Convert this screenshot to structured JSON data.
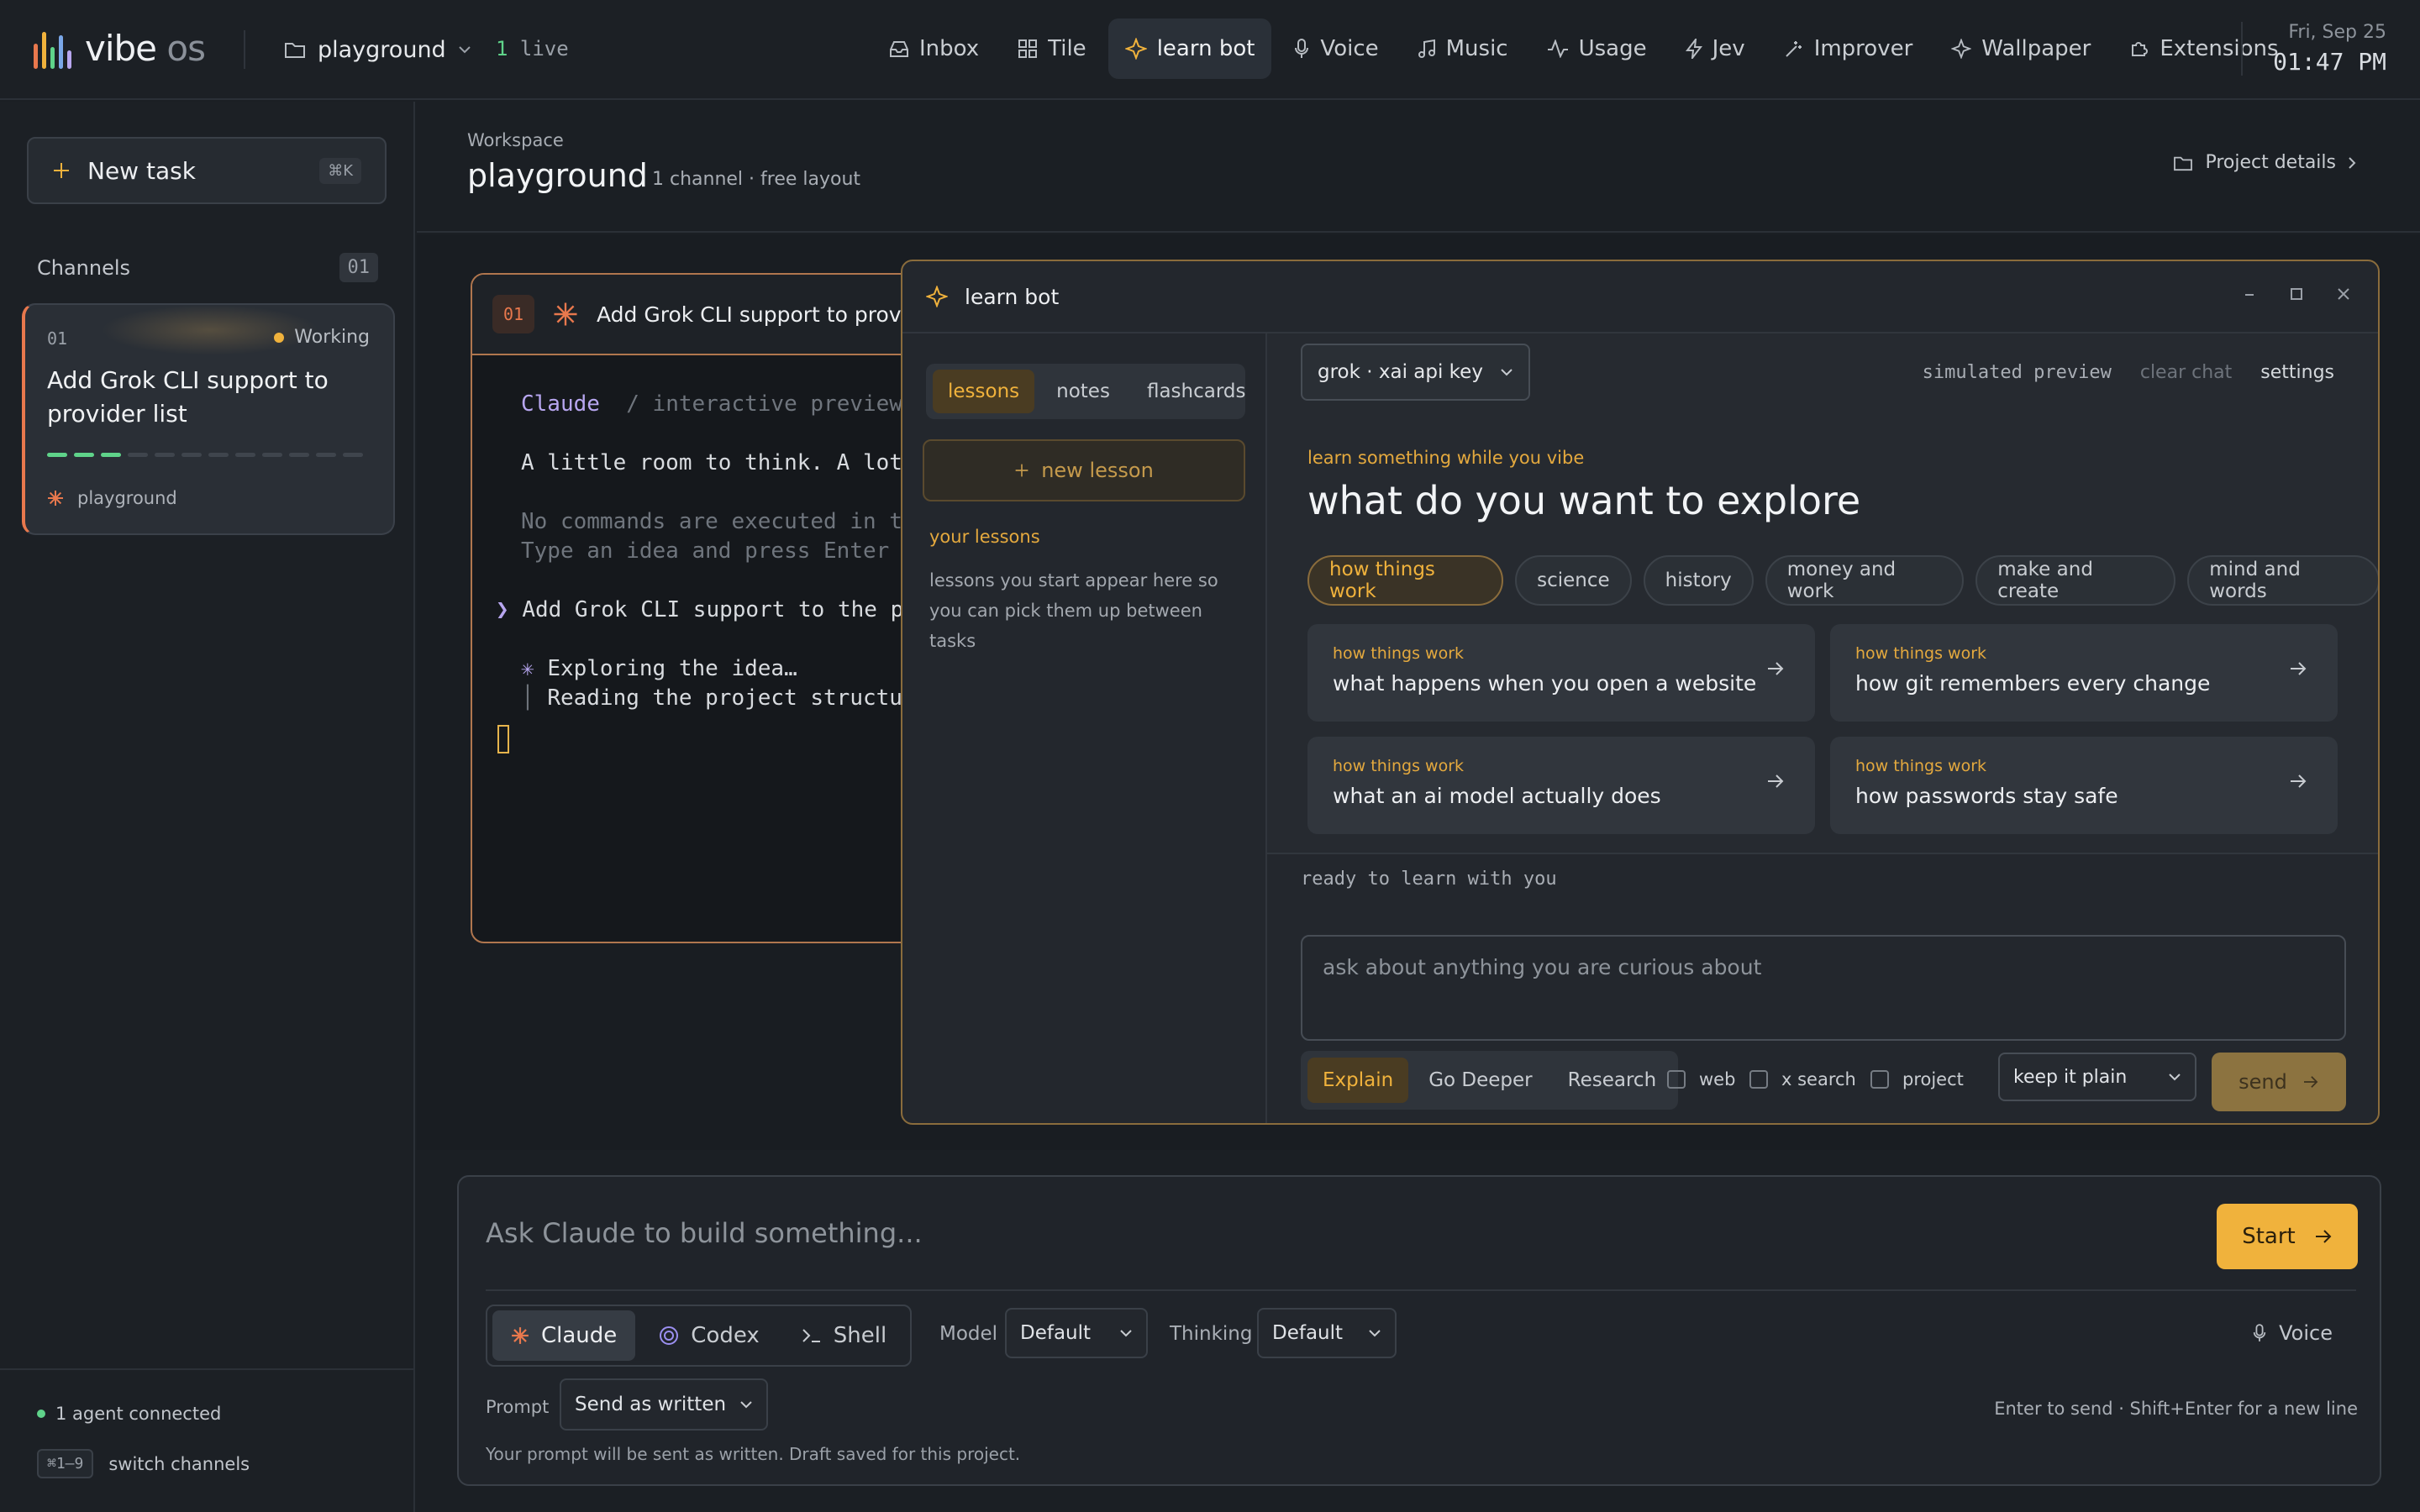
{
  "brand": {
    "name": "vibe",
    "suffix": "os",
    "bar_colors": [
      "#e8784d",
      "#f0b23c",
      "#5fd38a",
      "#7aa7e8",
      "#b7a6ef"
    ]
  },
  "header": {
    "project": "playground",
    "live_count": "1",
    "live_label": "live",
    "nav": [
      {
        "label": "Inbox",
        "icon": "inbox-icon"
      },
      {
        "label": "Tile",
        "icon": "grid-icon"
      },
      {
        "label": "learn bot",
        "icon": "sparkle-icon",
        "active": true
      },
      {
        "label": "Voice",
        "icon": "mic-icon"
      },
      {
        "label": "Music",
        "icon": "music-icon"
      },
      {
        "label": "Usage",
        "icon": "activity-icon"
      },
      {
        "label": "Jev",
        "icon": "bolt-icon"
      },
      {
        "label": "Improver",
        "icon": "wand-icon"
      },
      {
        "label": "Wallpaper",
        "icon": "sparkle-icon"
      },
      {
        "label": "Extensions",
        "icon": "puzzle-icon"
      }
    ],
    "date": "Fri, Sep 25",
    "time": "01:47 PM"
  },
  "sidebar": {
    "new_task": "New task",
    "new_task_shortcut": "⌘K",
    "channels_label": "Channels",
    "channels_count": "01",
    "channel": {
      "num": "01",
      "status": "Working",
      "title": "Add Grok CLI support to provider list",
      "project": "playground",
      "progress_done": 3,
      "progress_total": 12
    },
    "agents": "1 agent connected",
    "switch_shortcut": "⌘1–9",
    "switch_label": "switch channels"
  },
  "workspace": {
    "label": "Workspace",
    "title": "playground",
    "meta": "1 channel · free layout",
    "details": "Project details"
  },
  "terminal": {
    "num": "01",
    "title": "Add Grok CLI support to provider",
    "agent": "Claude",
    "mode": "/ interactive preview",
    "line1": "A little room to think. A lot of",
    "line2": "No commands are executed in this",
    "line3": "Type an idea and press Enter to",
    "prompt_glyph": "❯",
    "prompt": "Add Grok CLI support to the prov",
    "spinner": "✳",
    "step1": "Exploring the idea…",
    "step_bar": "│",
    "step2": "Reading the project structure"
  },
  "learnbot": {
    "title": "learn bot",
    "tabs": [
      "lessons",
      "notes",
      "flashcards"
    ],
    "new_lesson": "new lesson",
    "your_lessons": "your lessons",
    "lessons_empty": "lessons you start appear here so you can pick them up between tasks",
    "model": "grok · xai api key",
    "links": {
      "preview": "simulated preview",
      "clear": "clear chat",
      "settings": "settings"
    },
    "kicker": "learn something while you vibe",
    "heading": "what do you want to explore",
    "topics": [
      "how things work",
      "science",
      "history",
      "money and work",
      "make and create",
      "mind and words"
    ],
    "cards": [
      {
        "kicker": "how things work",
        "title": "what happens when you open a website"
      },
      {
        "kicker": "how things work",
        "title": "how git remembers every change"
      },
      {
        "kicker": "how things work",
        "title": "what an ai model actually does"
      },
      {
        "kicker": "how things work",
        "title": "how passwords stay safe"
      }
    ],
    "status": "ready to learn with you",
    "input_placeholder": "ask about anything you are curious about",
    "modes": [
      "Explain",
      "Go Deeper",
      "Research"
    ],
    "checks": [
      "web",
      "x search",
      "project"
    ],
    "tone": "keep it plain",
    "send": "send"
  },
  "composer": {
    "placeholder": "Ask Claude to build something...",
    "start": "Start",
    "agents": [
      {
        "label": "Claude",
        "icon": "asterisk-icon",
        "active": true
      },
      {
        "label": "Codex",
        "icon": "codex-icon"
      },
      {
        "label": "Shell",
        "icon": "terminal-icon"
      }
    ],
    "model_label": "Model",
    "model_value": "Default",
    "thinking_label": "Thinking",
    "thinking_value": "Default",
    "voice": "Voice",
    "prompt_label": "Prompt",
    "prompt_value": "Send as written",
    "hint": "Enter to send · Shift+Enter for a new line",
    "note": "Your prompt will be sent as written. Draft saved for this project."
  }
}
